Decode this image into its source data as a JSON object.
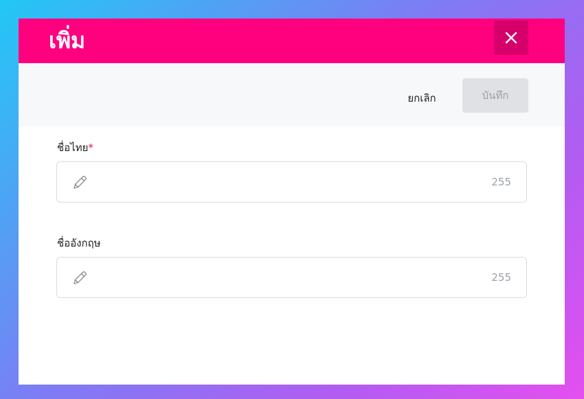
{
  "dialog": {
    "title": "เพิ่ม",
    "close_icon": "close-icon"
  },
  "toolbar": {
    "cancel_label": "ยกเลิก",
    "save_label": "บันทึก"
  },
  "fields": [
    {
      "label": "ชื่อไทย",
      "required_mark": "*",
      "value": "",
      "counter": "255",
      "icon": "pencil-icon"
    },
    {
      "label": "ชื่ออังกฤษ",
      "value": "",
      "counter": "255",
      "icon": "pencil-icon"
    }
  ],
  "colors": {
    "header": "#ff007f",
    "close_button": "#d6006b",
    "required": "#e6133c",
    "save_disabled_bg": "#dfe1e4"
  }
}
